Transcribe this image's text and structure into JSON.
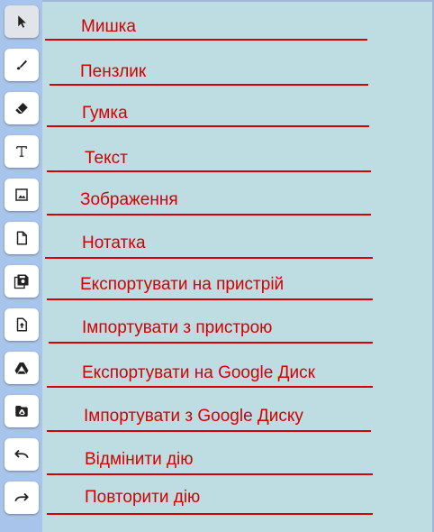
{
  "colors": {
    "sidebar": "#a8c4ea",
    "canvas": "#bddde3",
    "annotation": "#d40000"
  },
  "tools": [
    {
      "icon": "cursor-arrow-icon",
      "label": "Мишка",
      "active": true
    },
    {
      "icon": "brush-icon",
      "label": "Пензлик"
    },
    {
      "icon": "eraser-icon",
      "label": "Гумка"
    },
    {
      "icon": "text-t-icon",
      "label": "Текст"
    },
    {
      "icon": "image-icon",
      "label": "Зображення"
    },
    {
      "icon": "note-page-icon",
      "label": "Нотатка"
    },
    {
      "icon": "save-floppy-icon",
      "label": "Експортувати на пристрій"
    },
    {
      "icon": "file-upload-icon",
      "label": "Імпортувати з пристрою"
    },
    {
      "icon": "google-drive-icon",
      "label": "Експортувати на Google Диск"
    },
    {
      "icon": "drive-folder-icon",
      "label": "Імпортувати з Google Диску"
    },
    {
      "icon": "undo-icon",
      "label": "Відмінити дію"
    },
    {
      "icon": "redo-icon",
      "label": "Повторити дію"
    }
  ]
}
